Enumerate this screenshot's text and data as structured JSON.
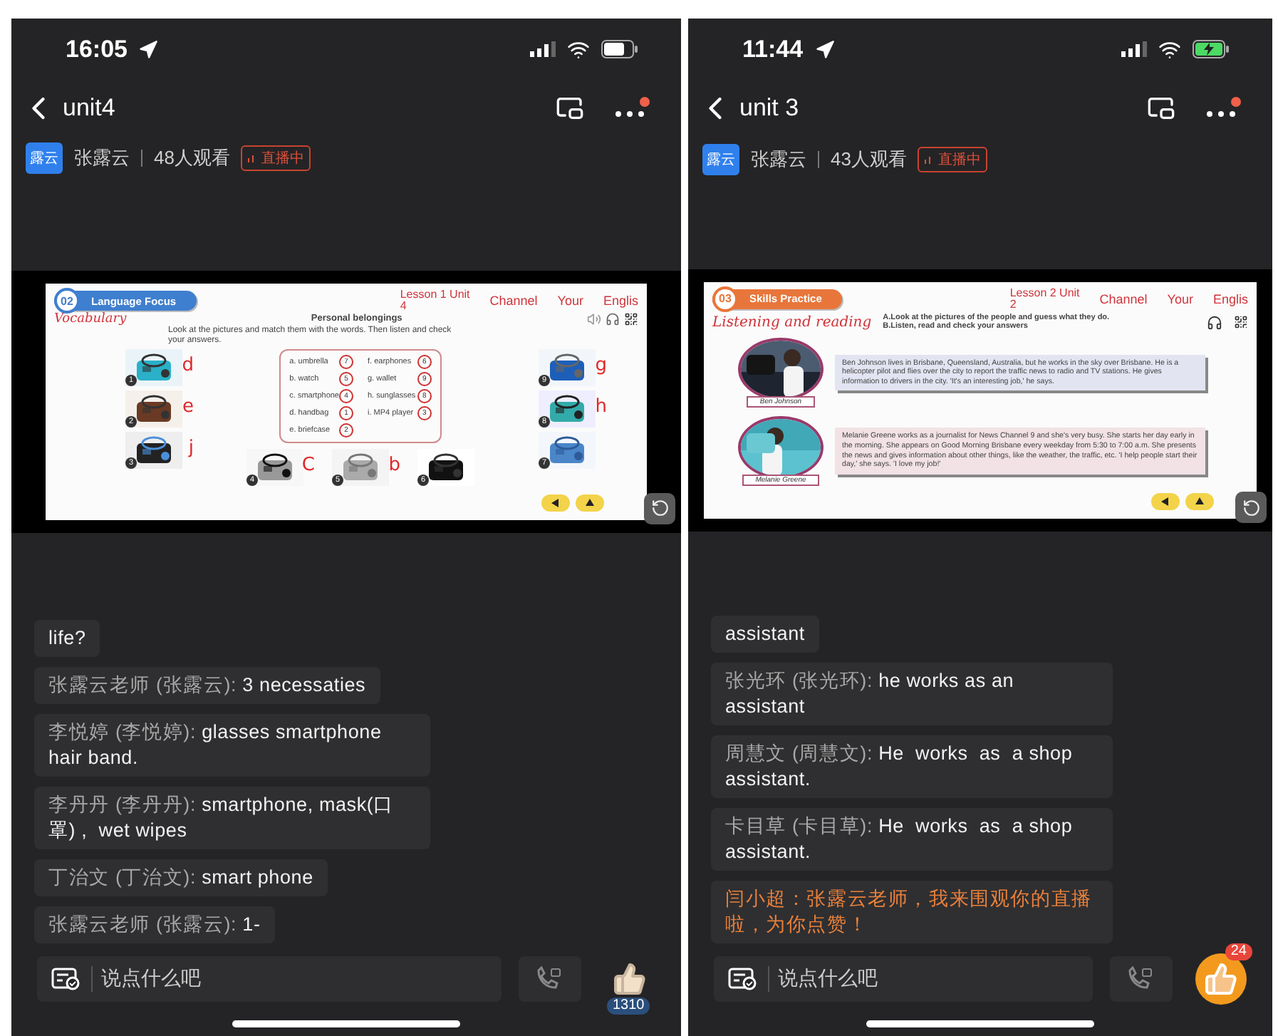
{
  "phones": [
    {
      "status_bar": {
        "time": "16:05",
        "charging": false
      },
      "nav": {
        "title": "unit4"
      },
      "host": {
        "avatar_label": "露云",
        "name": "张露云",
        "viewers": "48人观看",
        "live_badge": "直播中"
      },
      "slide": {
        "kind": "vocabulary",
        "section_number": "02",
        "section_title": "Language Focus",
        "lesson": "Lesson 1 Unit",
        "lesson_number": "4",
        "header_words": [
          "Channel",
          "Your",
          "Englis"
        ],
        "subtitle": "Vocabulary",
        "heading": "Personal belongings",
        "instructions": [
          "Look at the pictures and match them with the words. Then listen and check your answers."
        ],
        "matches": [
          {
            "word": "a. umbrella",
            "answer": "7"
          },
          {
            "word": "b. watch",
            "answer": "5"
          },
          {
            "word": "c. smartphone",
            "answer": "4"
          },
          {
            "word": "d. handbag",
            "answer": "1"
          },
          {
            "word": "e. briefcase",
            "answer": "2"
          },
          {
            "word": "f. earphones",
            "answer": "6"
          },
          {
            "word": "g. wallet",
            "answer": "9"
          },
          {
            "word": "h. sunglasses",
            "answer": "8"
          },
          {
            "word": "i. MP4 player",
            "answer": "3"
          }
        ],
        "items": [
          {
            "number": "1",
            "note": "d"
          },
          {
            "number": "2",
            "note": "e"
          },
          {
            "number": "3",
            "note": "j"
          },
          {
            "number": "4",
            "note": "C"
          },
          {
            "number": "5",
            "note": "b"
          },
          {
            "number": "6"
          },
          {
            "number": "9",
            "note": "g"
          },
          {
            "number": "8",
            "note": "h"
          },
          {
            "number": "7"
          }
        ]
      },
      "chat": [
        {
          "kind": "message",
          "text": "life?"
        },
        {
          "kind": "message",
          "sender": "张露云老师 (张露云):",
          "text": "3 necessaties"
        },
        {
          "kind": "message",
          "sender": "李悦婷 (李悦婷):",
          "text": "glasses smartphone  hair band."
        },
        {
          "kind": "message",
          "sender": "李丹丹 (李丹丹):",
          "text": "smartphone, mask(口罩) ,  wet wipes"
        },
        {
          "kind": "message",
          "sender": "丁治文 (丁治文):",
          "text": "smart phone"
        },
        {
          "kind": "message",
          "sender": "张露云老师 (张露云):",
          "text": "1-"
        }
      ],
      "input": {
        "placeholder": "说点什么吧"
      },
      "like": {
        "liked": false,
        "count": "1310"
      }
    },
    {
      "status_bar": {
        "time": "11:44",
        "charging": true
      },
      "nav": {
        "title": "unit 3"
      },
      "host": {
        "avatar_label": "露云",
        "name": "张露云",
        "viewers": "43人观看",
        "live_badge": "直播中"
      },
      "slide": {
        "kind": "reading",
        "section_number": "03",
        "section_title": "Skills Practice",
        "lesson": "Lesson 2 Unit",
        "lesson_number": "2",
        "header_words": [
          "Channel",
          "Your",
          "Englis"
        ],
        "subtitle": "Listening and reading",
        "instructions": [
          "A.Look at the pictures of the people and guess what they do.",
          "B.Listen, read and check your answers"
        ],
        "profiles": [
          {
            "name": "Ben Johnson",
            "color": "#e3e4f2",
            "text": "Ben Johnson lives in Brisbane, Queensland, Australia, but he works in the sky over Brisbane. He is a helicopter pilot and flies over the city to report the traffic news to radio and TV stations. He gives information to drivers in the city. 'It's an interesting job,' he says."
          },
          {
            "name": "Melanie Greene",
            "color": "#f2e2e5",
            "text": "Melanie Greene works as a journalist for News Channel 9 and she's very busy. She starts her day early in the morning. She appears on Good Morning Brisbane every weekday from 5:30 to 7:00 a.m. She presents the news and gives information about other things, like the weather, the traffic, etc. 'I help people start their day,' she says. 'I love my job!'"
          }
        ]
      },
      "chat": [
        {
          "kind": "message",
          "text": "assistant"
        },
        {
          "kind": "message",
          "sender": "张光环 (张光环):",
          "text": "he works as an assistant"
        },
        {
          "kind": "message",
          "sender": "周慧文 (周慧文):",
          "text": "He  works  as  a shop  assistant."
        },
        {
          "kind": "message",
          "sender": "卡目草 (卡目草):",
          "text": "He  works  as  a shop  assistant."
        },
        {
          "kind": "notice",
          "text": "闫小超：张露云老师，我来围观你的直播啦，为你点赞！"
        }
      ],
      "input": {
        "placeholder": "说点什么吧"
      },
      "like": {
        "liked": true,
        "count": "24"
      }
    }
  ]
}
